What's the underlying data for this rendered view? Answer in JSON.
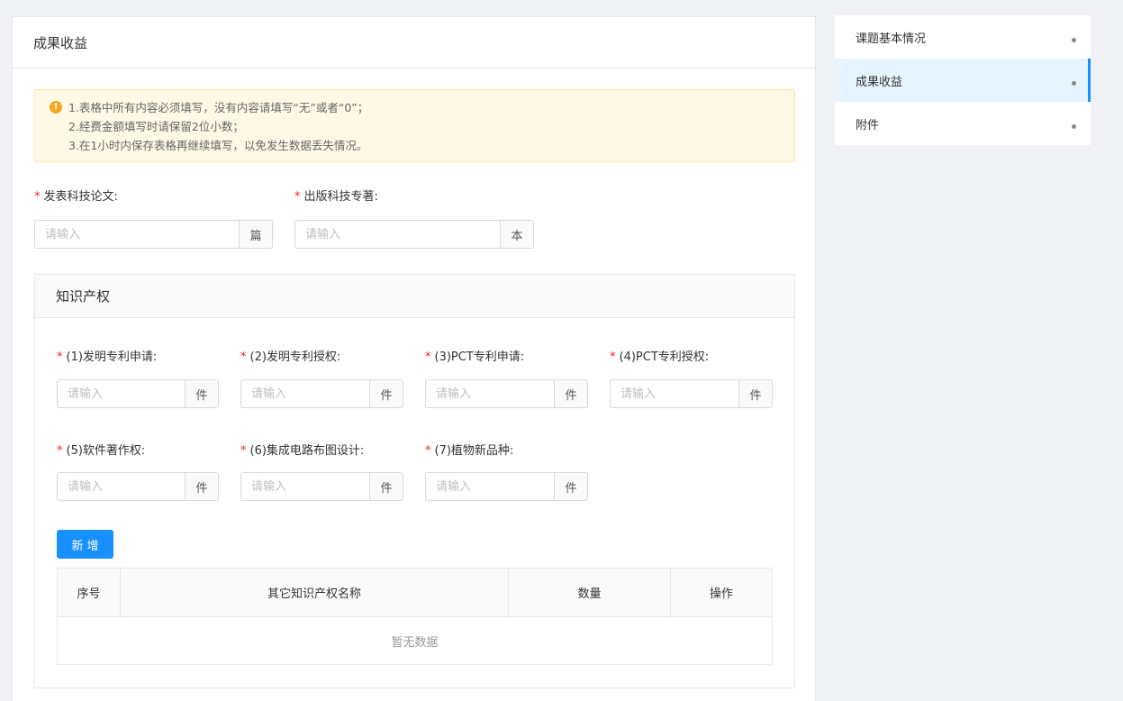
{
  "main": {
    "title": "成果收益",
    "notice": {
      "lines": [
        "1.表格中所有内容必须填写，没有内容请填写“无”或者“0”；",
        "2.经费金额填写时请保留2位小数；",
        "3.在1小时内保存表格再继续填写，以免发生数据丢失情况。"
      ]
    },
    "papers": {
      "label": "发表科技论文:",
      "placeholder": "请输入",
      "unit": "篇"
    },
    "books": {
      "label": "出版科技专著:",
      "placeholder": "请输入",
      "unit": "本"
    }
  },
  "ip": {
    "title": "知识产权",
    "fields": [
      {
        "label": "(1)发明专利申请:",
        "placeholder": "请输入",
        "unit": "件"
      },
      {
        "label": "(2)发明专利授权:",
        "placeholder": "请输入",
        "unit": "件"
      },
      {
        "label": "(3)PCT专利申请:",
        "placeholder": "请输入",
        "unit": "件"
      },
      {
        "label": "(4)PCT专利授权:",
        "placeholder": "请输入",
        "unit": "件"
      },
      {
        "label": "(5)软件著作权:",
        "placeholder": "请输入",
        "unit": "件"
      },
      {
        "label": "(6)集成电路布图设计:",
        "placeholder": "请输入",
        "unit": "件"
      },
      {
        "label": "(7)植物新品种:",
        "placeholder": "请输入",
        "unit": "件"
      }
    ],
    "add_button": "新增",
    "table": {
      "columns": [
        "序号",
        "其它知识产权名称",
        "数量",
        "操作"
      ],
      "empty_text": "暂无数据"
    }
  },
  "sidebar": {
    "items": [
      {
        "label": "课题基本情况"
      },
      {
        "label": "成果收益"
      },
      {
        "label": "附件"
      }
    ],
    "active_index": 1
  },
  "colors": {
    "primary": "#1890ff",
    "required": "#f5222d",
    "warning": "#f5a623"
  }
}
